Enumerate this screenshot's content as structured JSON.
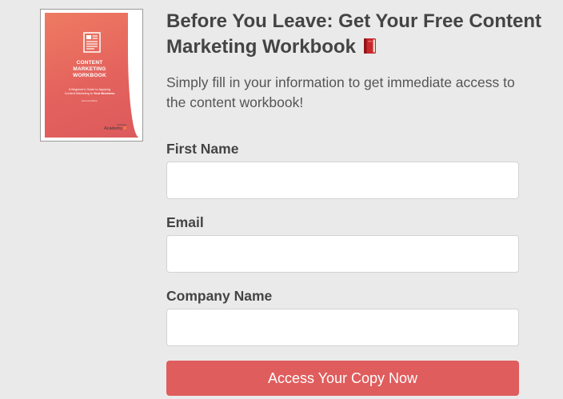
{
  "colors": {
    "page_background": "#eaeaea",
    "accent": "#e05d5d",
    "heading_text": "#444444",
    "body_text": "#555555"
  },
  "cover": {
    "title_lines": [
      "CONTENT",
      "MARKETING",
      "WORKBOOK"
    ],
    "subtitle_line1": "A Beginner's Guide to Applying",
    "subtitle_line2_prefix": "Content Marketing to ",
    "subtitle_line2_bold": "Your Business",
    "edition": "Second Edition",
    "brand_top": "HubSpot",
    "brand_main": "Academy",
    "icon": "document-icon"
  },
  "headline": {
    "text": "Before You Leave: Get Your Free Content Marketing Workbook",
    "icon": "red-book-icon"
  },
  "intro": "Simply fill in your information to get immediate access to the content workbook!",
  "form": {
    "fields": [
      {
        "label": "First Name",
        "value": "",
        "placeholder": ""
      },
      {
        "label": "Email",
        "value": "",
        "placeholder": ""
      },
      {
        "label": "Company Name",
        "value": "",
        "placeholder": ""
      }
    ],
    "submit_label": "Access Your Copy Now"
  }
}
